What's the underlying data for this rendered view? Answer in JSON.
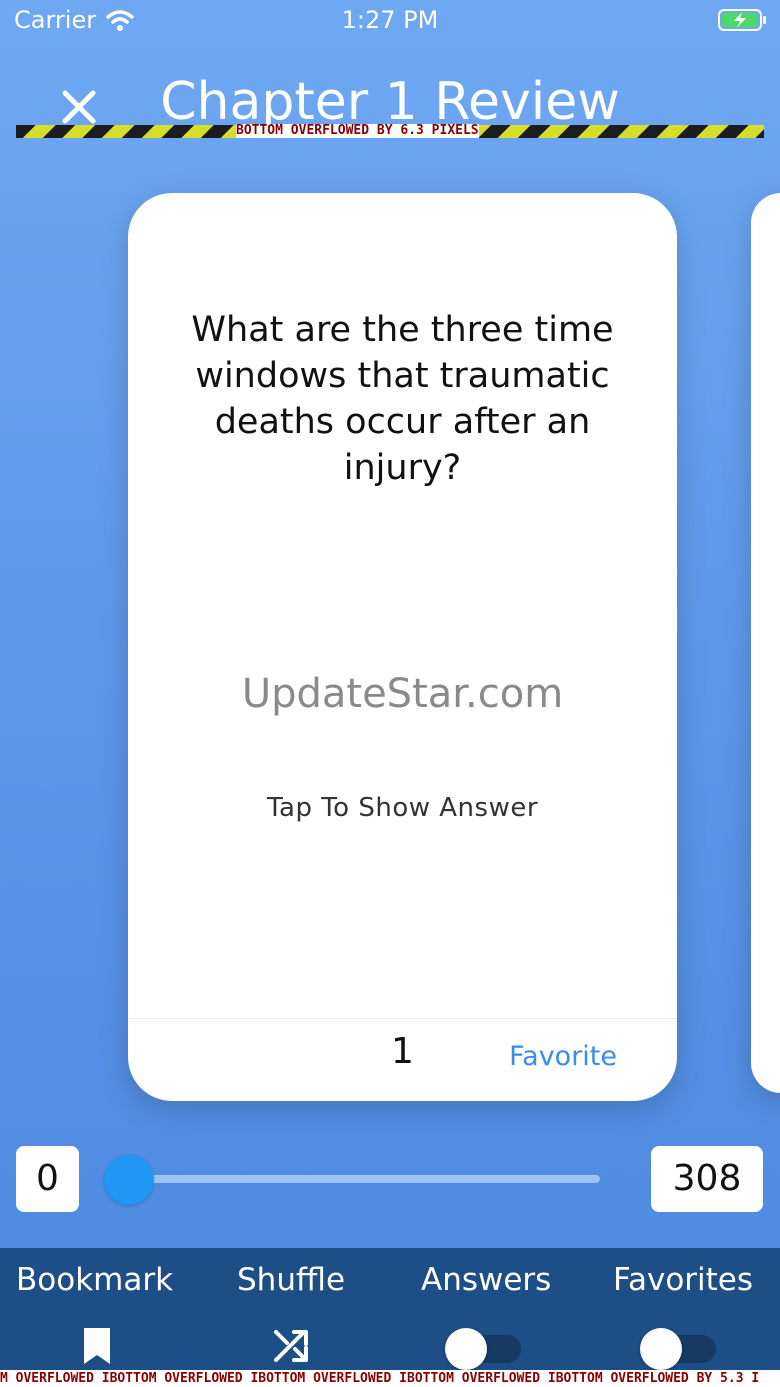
{
  "status_bar": {
    "carrier": "Carrier",
    "time": "1:27 PM"
  },
  "header": {
    "title": "Chapter 1 Review"
  },
  "debug": {
    "top_overflow": "BOTTOM OVERFLOWED BY 6.3 PIXELS",
    "bottom_overflow": "M OVERFLOWED IBOTTOM OVERFLOWED IBOTTOM OVERFLOWED IBOTTOM OVERFLOWED IBOTTOM OVERFLOWED BY 5.3 I"
  },
  "card": {
    "question": "What are the three time windows that traumatic deaths occur after an injury?",
    "watermark": "UpdateStar.com",
    "tap_hint": "Tap To Show Answer",
    "number": "1",
    "favorite_label": "Favorite"
  },
  "slider": {
    "min_label": "0",
    "max_label": "308",
    "value": 0
  },
  "bottom_nav": {
    "bookmark": "Bookmark",
    "shuffle": "Shuffle",
    "answers": "Answers",
    "favorites": "Favorites"
  },
  "toggles": {
    "answers_on": false,
    "favorites_on": false
  },
  "colors": {
    "accent": "#3B8BEA",
    "nav_bg": "#1E4E86",
    "slider_thumb": "#2196F3"
  }
}
